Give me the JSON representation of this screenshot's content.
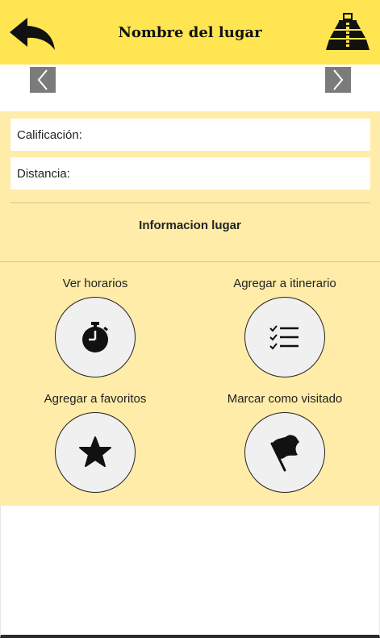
{
  "header": {
    "title": "Nombre del lugar",
    "back_icon": "back-arrow-icon",
    "logo_icon": "pyramid-icon",
    "background": "#ffe552"
  },
  "carousel": {
    "prev_icon": "chevron-left-icon",
    "next_icon": "chevron-right-icon"
  },
  "info": {
    "rating_label": "Calificación:",
    "distance_label": "Distancia:",
    "section_title": "Informacion lugar",
    "background": "#ffeca8"
  },
  "actions": [
    {
      "label": "Ver horarios",
      "icon": "stopwatch-icon"
    },
    {
      "label": "Agregar a itinerario",
      "icon": "checklist-icon"
    },
    {
      "label": "Agregar a favoritos",
      "icon": "star-icon"
    },
    {
      "label": "Marcar como visitado",
      "icon": "flag-icon"
    }
  ]
}
